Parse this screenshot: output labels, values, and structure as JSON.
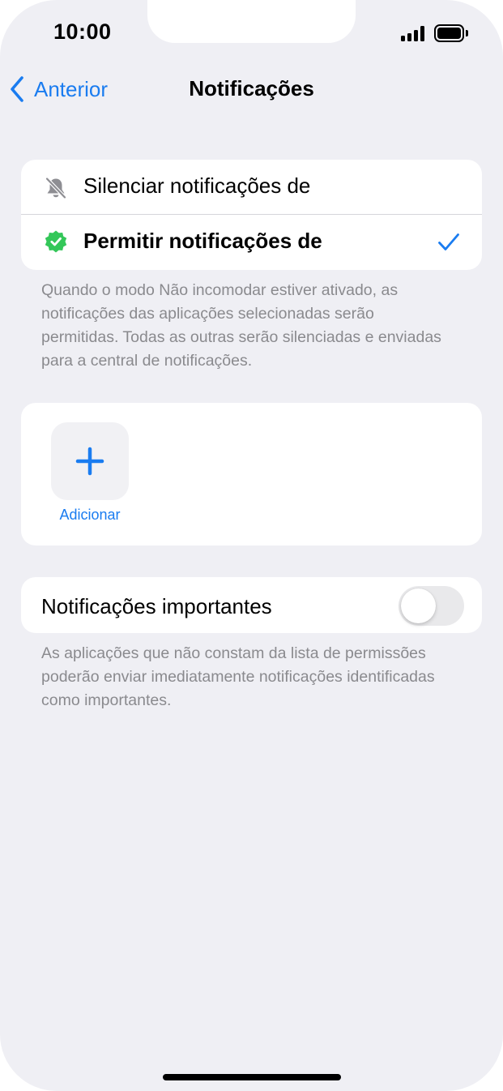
{
  "status_bar": {
    "time": "10:00"
  },
  "nav": {
    "back_label": "Anterior",
    "title": "Notificações"
  },
  "options": {
    "silence": {
      "label": "Silenciar notificações de",
      "icon": "bell-slash-icon",
      "selected": false
    },
    "allow": {
      "label": "Permitir notificações de",
      "icon": "verified-badge-icon",
      "selected": true
    }
  },
  "options_footnote": "Quando o modo Não incomodar estiver ativado, as notificações das aplicações selecionadas serão permitidas. Todas as outras serão silenciadas e enviadas para a central de notificações.",
  "add_apps": {
    "label": "Adicionar",
    "icon": "plus-icon"
  },
  "important": {
    "label": "Notificações importantes",
    "enabled": false
  },
  "important_footnote": "As aplicações que não constam da lista de permissões poderão enviar imediatamente notificações identificadas como importantes.",
  "colors": {
    "accent": "#1a7cf0",
    "background": "#efeff4",
    "verified_green": "#34c759",
    "secondary_text": "#8a8a8e"
  }
}
